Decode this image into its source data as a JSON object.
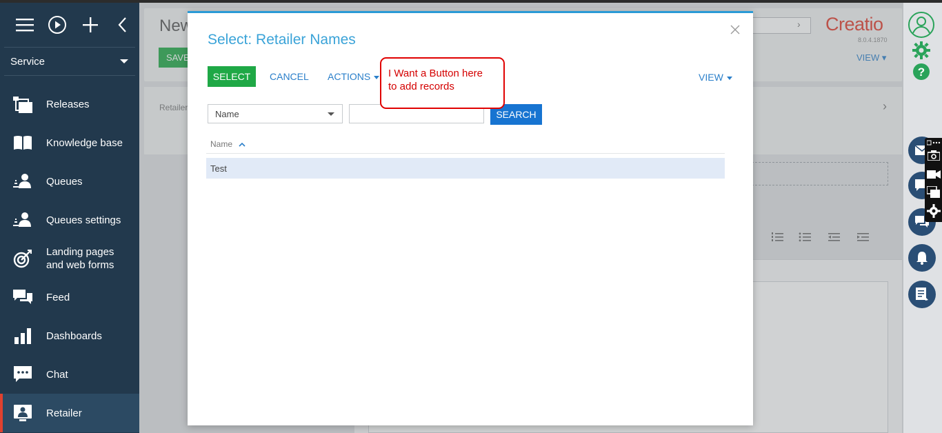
{
  "sidebar": {
    "workspace": "Service",
    "items": [
      {
        "label": "Releases",
        "icon": "releases-icon"
      },
      {
        "label": "Knowledge base",
        "icon": "book-icon"
      },
      {
        "label": "Queues",
        "icon": "queue-icon"
      },
      {
        "label": "Queues settings",
        "icon": "queue-settings-icon"
      },
      {
        "label_1": "Landing pages",
        "label_2": "and web forms",
        "icon": "target-icon"
      },
      {
        "label": "Feed",
        "icon": "feed-icon"
      },
      {
        "label": "Dashboards",
        "icon": "dashboards-icon"
      },
      {
        "label": "Chat",
        "icon": "chat-icon"
      },
      {
        "label": "Retailer",
        "icon": "retailer-icon",
        "active": true
      }
    ]
  },
  "background": {
    "title": "New",
    "save_label": "SAVE",
    "card_label": "Retailer",
    "view_label": "VIEW",
    "logo": "Creatio",
    "version": "8.0.4.1870"
  },
  "modal": {
    "title": "Select: Retailer Names",
    "select_label": "SELECT",
    "cancel_label": "CANCEL",
    "actions_label": "ACTIONS",
    "view_label": "VIEW",
    "filter_column": "Name",
    "search_value": "",
    "search_label": "SEARCH",
    "column_header": "Name",
    "rows": [
      "Test"
    ]
  },
  "annotation": {
    "line1": "I Want a Button here",
    "line2": "to add records"
  },
  "colors": {
    "sidebar": "#22394d",
    "accent_green": "#1fa846",
    "accent_blue": "#1774d1",
    "link_blue": "#2a7fca",
    "title_blue": "#3aa3d8",
    "brand_red": "#e13b2c"
  }
}
